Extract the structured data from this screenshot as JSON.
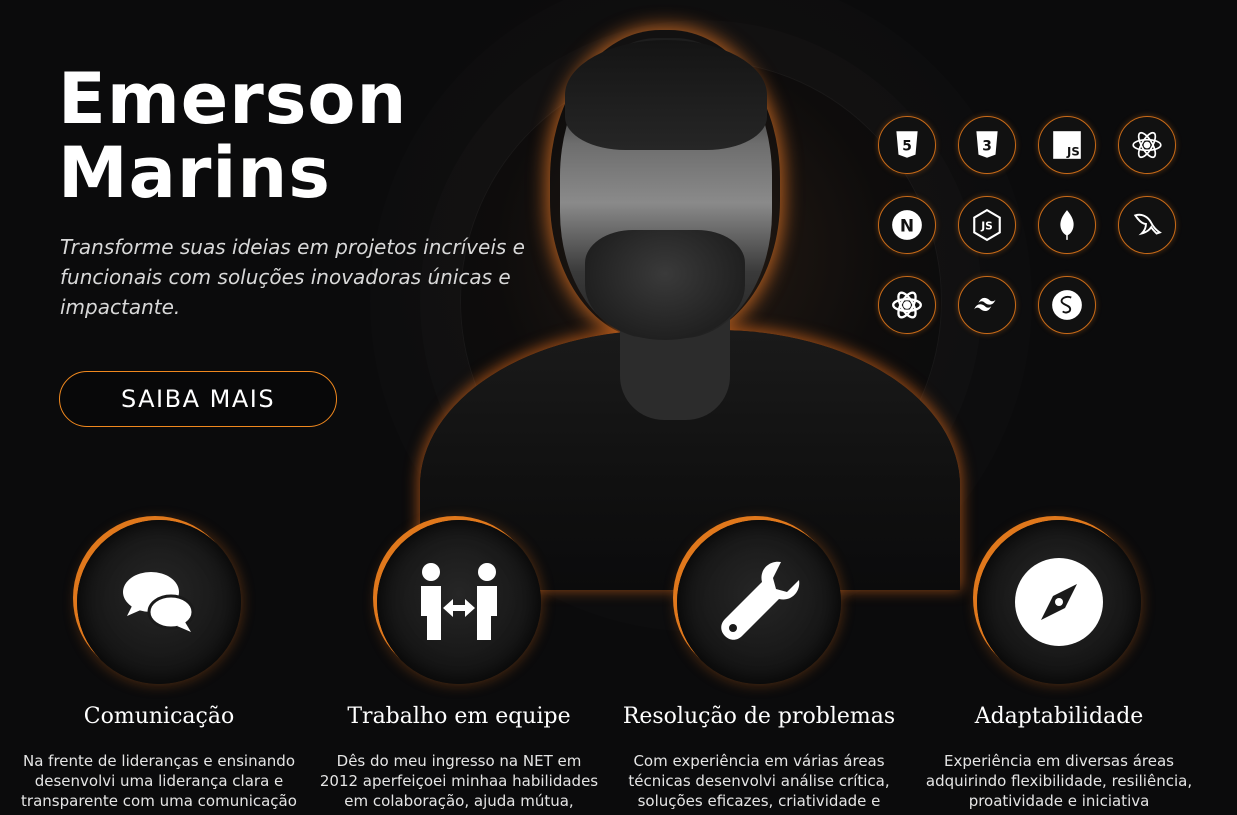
{
  "hero": {
    "name_line1": "Emerson",
    "name_line2": "Marins",
    "tagline": "Transforme suas ideias em projetos incríveis e funcionais com soluções inovadoras únicas e impactante.",
    "cta_label": "SAIBA MAIS"
  },
  "theme": {
    "accent": "#f0881e",
    "background": "#0b0b0c",
    "text": "#ffffff"
  },
  "skills": [
    {
      "icon": "html5-icon",
      "text": "5"
    },
    {
      "icon": "css3-icon",
      "text": "3"
    },
    {
      "icon": "javascript-icon",
      "text": "JS"
    },
    {
      "icon": "react-icon",
      "text": ""
    },
    {
      "icon": "nextjs-icon",
      "text": "N"
    },
    {
      "icon": "nodejs-icon",
      "text": "JS"
    },
    {
      "icon": "mongodb-icon",
      "text": ""
    },
    {
      "icon": "mysql-icon",
      "text": ""
    },
    {
      "icon": "react-native-icon",
      "text": ""
    },
    {
      "icon": "tailwind-icon",
      "text": ""
    },
    {
      "icon": "sass-icon",
      "text": ""
    }
  ],
  "features": [
    {
      "icon": "chat-icon",
      "title": "Comunicação",
      "text": "Na frente de lideranças e ensinando desenvolvi uma liderança clara e transparente com uma comunicação"
    },
    {
      "icon": "teamwork-icon",
      "title": "Trabalho em equipe",
      "text": "Dês do meu ingresso na NET em 2012 aperfeiçoei minhaa habilidades em colaboração, ajuda mútua,"
    },
    {
      "icon": "wrench-icon",
      "title": "Resolução de problemas",
      "text": "Com experiência em várias áreas técnicas desenvolvi análise crítica, soluções eficazes, criatividade e"
    },
    {
      "icon": "compass-icon",
      "title": "Adaptabilidade",
      "text": "Experiência em diversas áreas adquirindo flexibilidade, resiliência, proatividade e iniciativa"
    }
  ]
}
